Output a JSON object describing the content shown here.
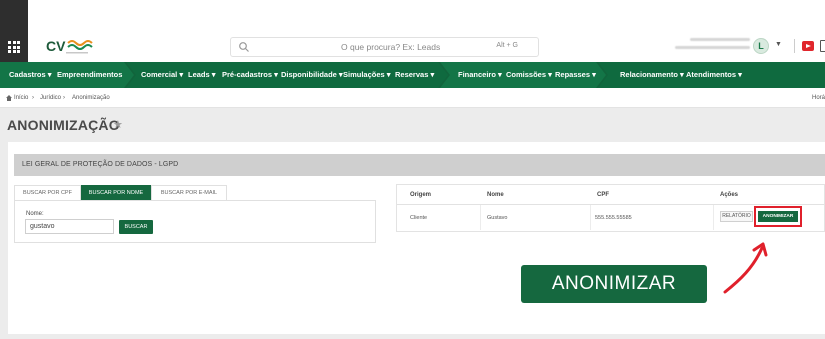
{
  "header": {
    "logo_text": "CV",
    "search_placeholder": "O que procura? Ex: Leads",
    "search_shortcut": "Alt + G",
    "avatar_initial": "L"
  },
  "nav": {
    "items": [
      "Cadastros",
      "Empreendimentos",
      "Comercial",
      "Leads",
      "Pré-cadastros",
      "Disponibilidade",
      "Simulações",
      "Reservas",
      "Financeiro",
      "Comissões",
      "Repasses",
      "Relacionamento",
      "Atendimentos"
    ]
  },
  "breadcrumb": {
    "items": [
      "Início",
      "Jurídico",
      "Anonimização"
    ],
    "right_text": "Horá"
  },
  "page": {
    "title": "ANONIMIZAÇÃO",
    "section_title": "LEI GERAL DE PROTEÇÃO DE DADOS - LGPD"
  },
  "search_tabs": [
    "BUSCAR POR CPF",
    "BUSCAR POR NOME",
    "BUSCAR POR E-MAIL"
  ],
  "search_form": {
    "label": "Nome:",
    "value": "gustavo",
    "button": "BUSCAR"
  },
  "results": {
    "columns": [
      "Origem",
      "Nome",
      "CPF",
      "Ações"
    ],
    "rows": [
      {
        "origem": "Cliente",
        "nome": "Gustavo",
        "cpf": "555.555.55585",
        "btn_relatorio": "RELATÓRIO",
        "btn_anonimizar": "ANONIMIZAR"
      }
    ]
  },
  "callout": {
    "label": "ANONIMIZAR"
  },
  "colors": {
    "brand_green": "#15683f",
    "highlight_red": "#e0202b"
  }
}
